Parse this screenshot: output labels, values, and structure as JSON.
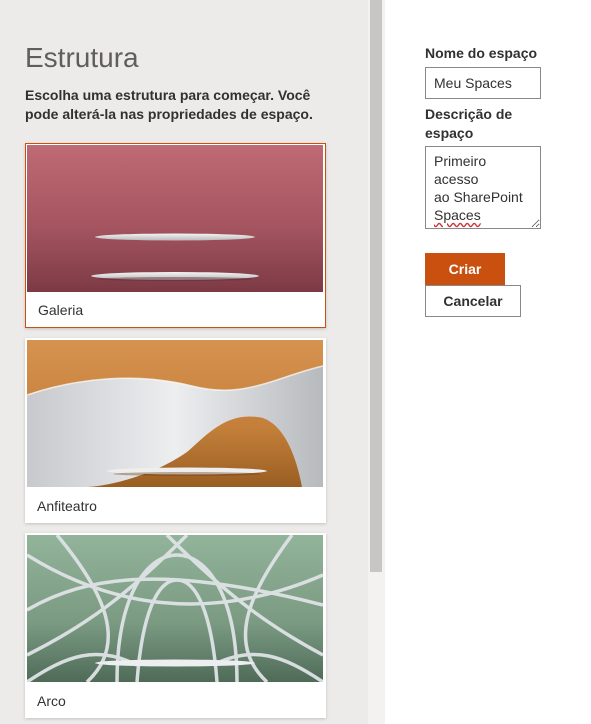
{
  "structure_panel": {
    "title": "Estrutura",
    "description": "Escolha uma estrutura para começar. Você pode alterá-la nas propriedades de espaço.",
    "options": [
      {
        "label": "Galeria",
        "selected": true
      },
      {
        "label": "Anfiteatro",
        "selected": false
      },
      {
        "label": "Arco",
        "selected": false
      }
    ]
  },
  "form": {
    "name_label": "Nome do espaço",
    "name_value": "Meu Spaces",
    "description_label": "Descrição de espaço",
    "description_lines": [
      "Primeiro acesso",
      "ao SharePoint",
      "Spaces"
    ],
    "create_button": "Criar",
    "cancel_button": "Cancelar"
  },
  "colors": {
    "accent": "#ca5010",
    "panel_background": "#edebe9",
    "gallery_background": "#b4646e",
    "amphitheater_background": "#c88a45",
    "arch_background": "#7f9f86"
  }
}
